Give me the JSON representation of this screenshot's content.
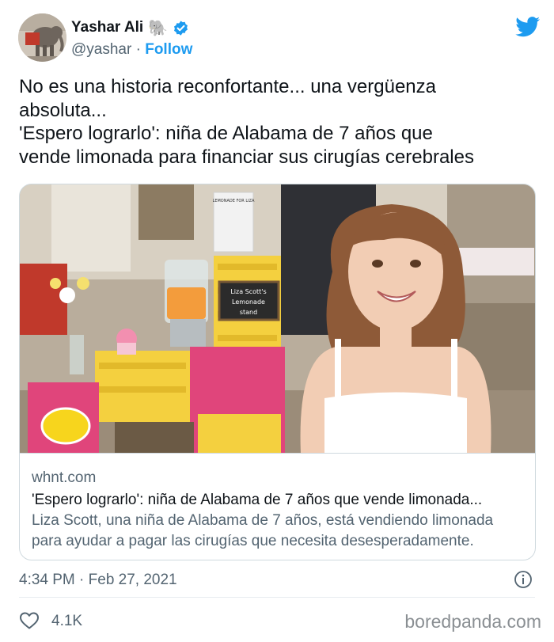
{
  "author": {
    "name": "Yashar Ali",
    "emoji": "🐘",
    "handle": "@yashar",
    "separator": "·",
    "follow_label": "Follow"
  },
  "tweet": {
    "lines": [
      "No es una historia reconfortante... una vergüenza",
      "absoluta...",
      "'Espero lograrlo': niña de Alabama de 7 años que",
      "vende limonada para financiar sus cirugías cerebrales"
    ]
  },
  "card": {
    "domain": "whnt.com",
    "title": "'Espero lograrlo': niña de Alabama de 7 años que vende limonada...",
    "description_lines": [
      "Liza Scott, una niña de Alabama de 7 años, está vendiendo limonada",
      "para ayudar a pagar las cirugías que necesita desesperadamente."
    ],
    "image": {
      "poster_text": "LEMONADE FOR LIZA",
      "chalkboard_lines": [
        "Liza Scott's",
        "Lemonade",
        "stand"
      ]
    }
  },
  "meta": {
    "timestamp": "4:34 PM · Feb 27, 2021"
  },
  "footer": {
    "likes": "4.1K",
    "watermark": "boredpanda.com"
  },
  "colors": {
    "accent": "#1d9bf0",
    "text": "#0f1419",
    "secondary": "#536471",
    "border": "#cfd9de"
  },
  "icons": [
    "verified-badge-icon",
    "twitter-bird-icon",
    "info-icon",
    "heart-icon",
    "elephant-emoji"
  ]
}
